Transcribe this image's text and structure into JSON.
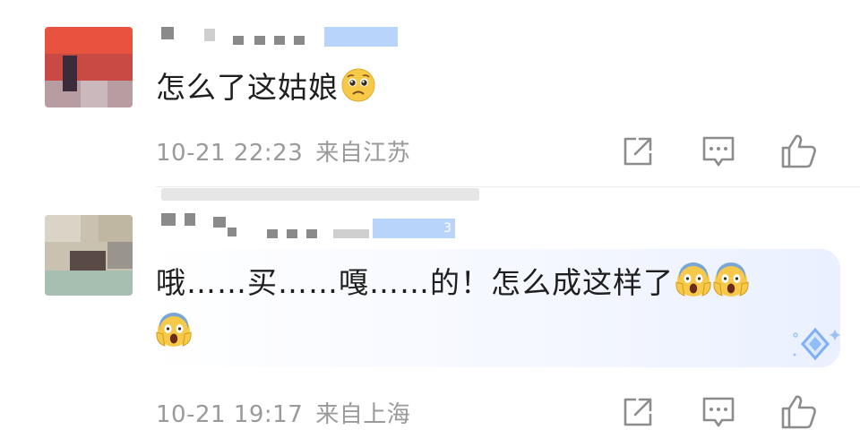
{
  "comments": [
    {
      "text": "怎么了这姑娘",
      "emoji": "pleading-face-icon",
      "time": "10-21 22:23",
      "location": "来自江苏"
    },
    {
      "text_line1": "哦……买……嘎……的！怎么成这样了",
      "emoji": "face-screaming-in-fear-icon",
      "emoji_count": 3,
      "badge_text": "3",
      "time": "10-21 19:17",
      "location": "来自上海"
    }
  ],
  "colors": {
    "meta_text": "#9a9a9a",
    "badge": "#b9d4fb",
    "icon_stroke": "#8c8c8c",
    "emoji_yellow": "#f7c948"
  }
}
